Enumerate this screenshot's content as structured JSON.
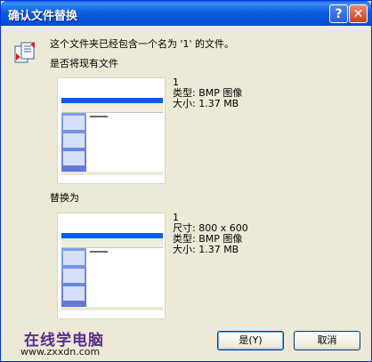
{
  "window": {
    "title": "确认文件替换"
  },
  "titlebar": {
    "help_glyph": "?",
    "close_glyph": "✕"
  },
  "message": {
    "line1": "这个文件夹已经包含一个名为 '1' 的文件。",
    "line2": "是否将现有文件",
    "line3": "替换为"
  },
  "existing_file": {
    "name": "1",
    "type": "类型: BMP 图像",
    "size": "大小: 1.37 MB"
  },
  "new_file": {
    "name": "1",
    "dimensions": "尺寸: 800 x 600",
    "type": "类型: BMP 图像",
    "size": "大小: 1.37 MB"
  },
  "buttons": {
    "yes": "是(Y)",
    "cancel": "取消"
  },
  "watermark": {
    "brand": "在线学电脑",
    "url": "www.zxxdn.com"
  },
  "icons": {
    "title_help": "help-icon",
    "title_close": "close-icon",
    "message": "file-replace-icon"
  }
}
